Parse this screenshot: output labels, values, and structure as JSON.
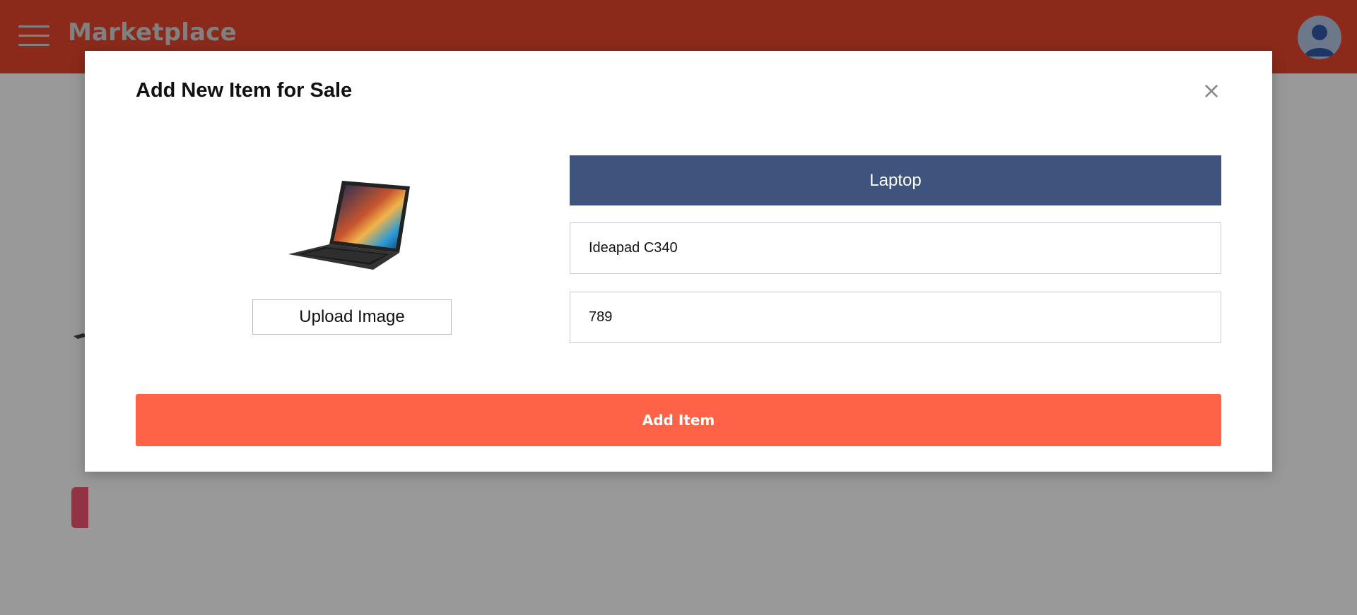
{
  "app": {
    "title": "Marketplace"
  },
  "icons": {
    "menu": "hamburger-menu-icon",
    "profile": "user-avatar-icon",
    "close": "close-icon",
    "preview": "laptop-image"
  },
  "modal": {
    "title": "Add New Item for Sale",
    "close_label": "×",
    "upload_label": "Upload Image",
    "category_value": "Laptop",
    "item_name_value": "Ideapad C340",
    "price_value": "789",
    "submit_label": "Add Item"
  },
  "colors": {
    "topbar": "#e8462c",
    "category_bg": "#3f547d",
    "submit_bg": "#ff6347",
    "overlay": "rgba(0,0,0,0.4)"
  }
}
